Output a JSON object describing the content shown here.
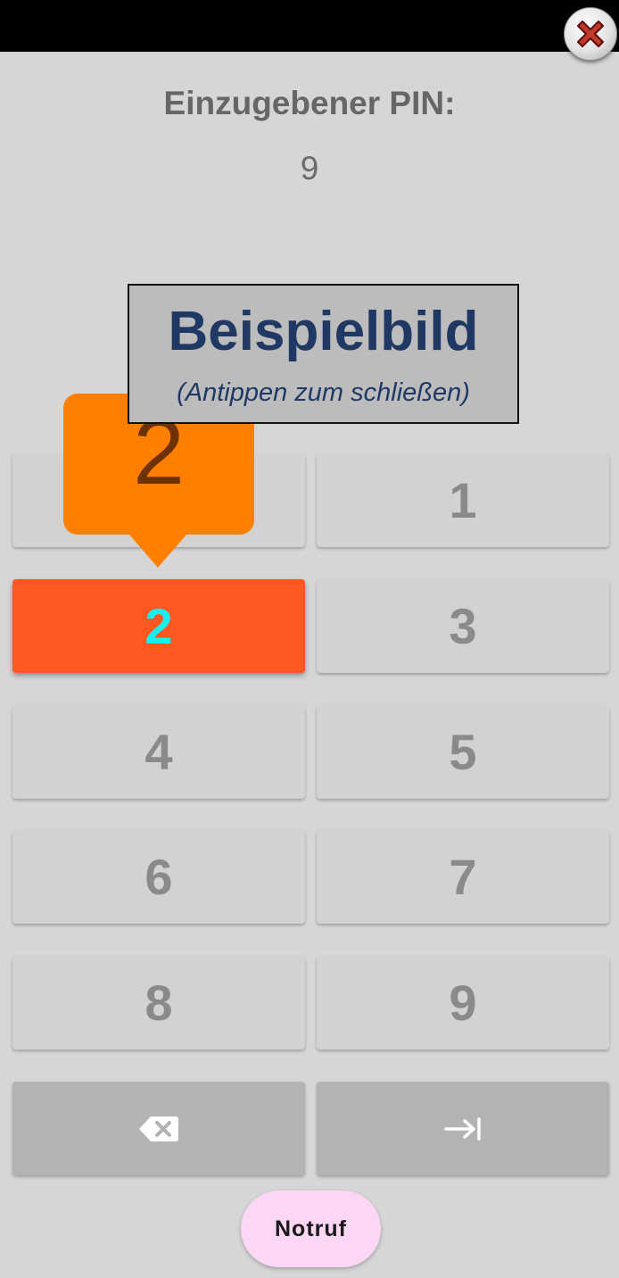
{
  "header": {
    "close_icon": "close-icon"
  },
  "pin": {
    "title": "Einzugebener PIN:",
    "value": "9"
  },
  "overlay": {
    "title": "Beispielbild",
    "subtitle": "(Antippen zum schließen)"
  },
  "popup": {
    "value": "2"
  },
  "keypad": {
    "keys": [
      "1",
      "2",
      "3",
      "4",
      "5",
      "6",
      "7",
      "8",
      "9"
    ],
    "active_key": "2",
    "backspace_icon": "backspace-icon",
    "enter_icon": "tab-arrow-icon"
  },
  "emergency": {
    "label": "Notruf"
  },
  "colors": {
    "background": "#d6d6d6",
    "key": "#d2d2d2",
    "active_key": "#ff5722",
    "active_key_text": "#18f0f0",
    "popup": "#ff8000",
    "overlay_text": "#203864",
    "emergency_button": "#fbd7f4"
  }
}
